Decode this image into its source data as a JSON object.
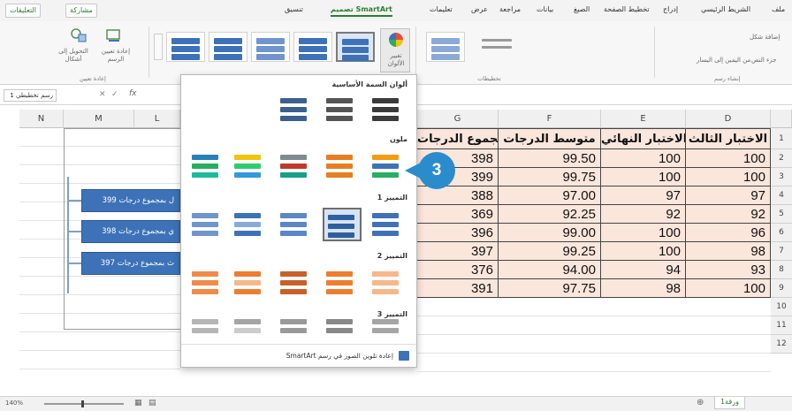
{
  "ribbon_tabs": [
    "ملف",
    "الشريط الرئيسي",
    "إدراج",
    "تخطيط الصفحة",
    "الصيغ",
    "بيانات",
    "مراجعة",
    "عرض",
    "تعليمات",
    "تصميم SmartArt",
    "تنسيق"
  ],
  "top_buttons": {
    "share": "مشاركة",
    "comments": "التعليقات"
  },
  "ribbon_left": {
    "add_shape": "إضافة شكل",
    "right_to_left": "من اليمين إلى اليسار",
    "text_pane": "جزء النص",
    "group_label": "إنشاء رسم",
    "layouts_label": "تخطيطات"
  },
  "ribbon_right": {
    "change_colors": "تغيير الألوان",
    "reset_graphic": "إعادة تعيين الرسم",
    "convert": "التحويل إلى أشكال",
    "reset_label": "إعادة تعيين"
  },
  "name_box": "رسم تخطيطي 1",
  "gallery": {
    "sections": [
      "ألوان السمة الأساسية",
      "ملون",
      "التمييز 1",
      "التمييز 2",
      "التمييز 3"
    ],
    "footer": "إعادة تلوين الصور في رسم SmartArt"
  },
  "callout_number": "3",
  "columns": [
    "D",
    "E",
    "F",
    "G",
    "L",
    "M",
    "N"
  ],
  "headers": [
    "الاختبار الثالث",
    "الاختبار النهائي",
    "متوسط الدرجات",
    "مجموع الدرجات"
  ],
  "rows": [
    {
      "d": "100",
      "e": "100",
      "f": "99.50",
      "g": "398"
    },
    {
      "d": "100",
      "e": "100",
      "f": "99.75",
      "g": "399"
    },
    {
      "d": "97",
      "e": "97",
      "f": "97.00",
      "g": "388"
    },
    {
      "d": "92",
      "e": "92",
      "f": "92.25",
      "g": "369"
    },
    {
      "d": "96",
      "e": "100",
      "f": "99.00",
      "g": "396"
    },
    {
      "d": "98",
      "e": "100",
      "f": "99.25",
      "g": "397"
    },
    {
      "d": "93",
      "e": "94",
      "f": "94.00",
      "g": "376"
    },
    {
      "d": "100",
      "e": "98",
      "f": "97.75",
      "g": "391"
    }
  ],
  "row_numbers": [
    "1",
    "2",
    "3",
    "4",
    "5",
    "6",
    "7",
    "8",
    "9",
    "10",
    "11",
    "12"
  ],
  "smartart_boxes": [
    "ل بمجموع درجات 399",
    "ي بمجموع درجات 398",
    "ث بمجموع درجات 397"
  ],
  "sheet_tab": "ورقة1",
  "zoom": "140%"
}
